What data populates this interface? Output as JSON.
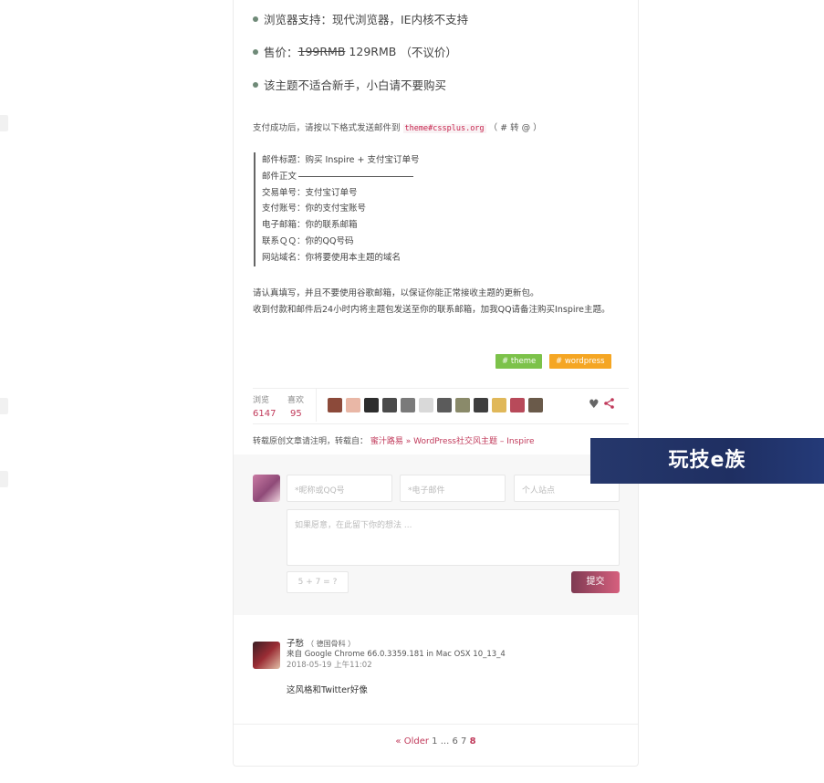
{
  "features": [
    {
      "label": "浏览器支持：现代浏览器，IE内核不支持"
    },
    {
      "label_prefix": "售价：",
      "old_price": "199RMB",
      "new_price": "129RMB",
      "note": "（不议价）"
    },
    {
      "label": "该主题不适合新手，小白请不要购买"
    }
  ],
  "payment": {
    "intro_prefix": "支付成功后，请按以下格式发送邮件到",
    "email": "theme#cssplus.org",
    "intro_suffix": "（ # 转 @ ）",
    "template_lines": [
      "邮件标题：购买 Inspire + 支付宝订单号",
      "邮件正文",
      "交易单号：支付宝订单号",
      "支付账号：你的支付宝账号",
      "电子邮箱：你的联系邮箱",
      "联系ＱＱ：你的QQ号码",
      "网站域名：你将要使用本主题的域名"
    ],
    "notes": [
      "请认真填写，并且不要使用谷歌邮箱，以保证你能正常接收主题的更新包。",
      "收到付款和邮件后24小时内将主题包发送至你的联系邮箱，加我QQ请备注购买Inspire主题。"
    ]
  },
  "tags": [
    "# theme",
    "# wordpress"
  ],
  "stats": {
    "views_label": "浏览",
    "views": "6147",
    "likes_label": "喜欢",
    "likes": "95"
  },
  "liker_avatars": [
    "#8c4a3a",
    "#e9b7a6",
    "#2d2d2d",
    "#4a4a4a",
    "#7a7a7a",
    "#d9d9d9",
    "#5b5b5b",
    "#8a8a6a",
    "#3e3e3e",
    "#e0b85a",
    "#b84a5a",
    "#6a5a4a"
  ],
  "repost": {
    "prefix": "转载原创文章请注明，转载自：",
    "site": "蜜汁路易",
    "sep": " » ",
    "post": "WordPress社交风主题 – Inspire"
  },
  "comment_form": {
    "name_placeholder": "*昵称或QQ号",
    "email_placeholder": "*电子邮件",
    "site_placeholder": "个人站点",
    "text_placeholder": "如果愿意，在此留下你的想法 ...",
    "captcha": "5 + 7 = ?",
    "submit": "提交"
  },
  "comment": {
    "author": "子愁",
    "author_note": "（ 德国骨科 ）",
    "meta": "来自 Google Chrome 66.0.3359.181 in Mac OSX 10_13_4",
    "time": "2018-05-19 上午11:02",
    "body": "这风格和Twitter好像"
  },
  "pager": {
    "older": "« Older",
    "p1": "1",
    "dots": "...",
    "p6": "6",
    "p7": "7",
    "current": "8"
  },
  "watermark": "玩技e族"
}
